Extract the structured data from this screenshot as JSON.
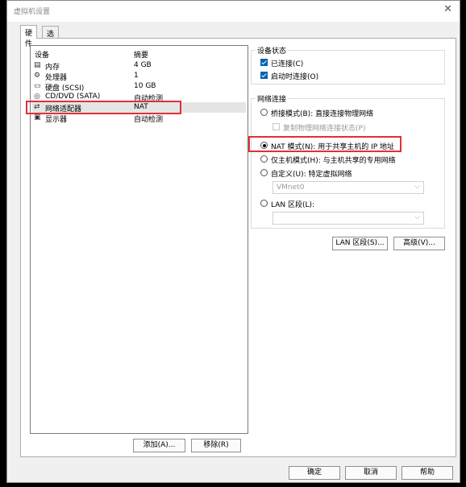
{
  "window": {
    "title": "虚拟机设置",
    "close_glyph": "✕"
  },
  "tabs": [
    {
      "label": "硬件",
      "active": true
    },
    {
      "label": "选项",
      "active": false
    }
  ],
  "device_list": {
    "col_device": "设备",
    "col_summary": "摘要",
    "items": [
      {
        "icon": "memory-icon",
        "glyph": "▤",
        "name": "内存",
        "summary": "4 GB"
      },
      {
        "icon": "processor-icon",
        "glyph": "⚙",
        "name": "处理器",
        "summary": "1"
      },
      {
        "icon": "disk-icon",
        "glyph": "▭",
        "name": "硬盘 (SCSI)",
        "summary": "10 GB"
      },
      {
        "icon": "cdrom-icon",
        "glyph": "◎",
        "name": "CD/DVD (SATA)",
        "summary": "自动检测"
      },
      {
        "icon": "network-icon",
        "glyph": "⇄",
        "name": "网络适配器",
        "summary": "NAT"
      },
      {
        "icon": "display-icon",
        "glyph": "▣",
        "name": "显示器",
        "summary": "自动检测"
      }
    ],
    "selected_index": 4
  },
  "buttons": {
    "add": "添加(A)...",
    "remove": "移除(R)",
    "ok": "确定",
    "cancel": "取消",
    "help": "帮助"
  },
  "device_status": {
    "title": "设备状态",
    "connected": {
      "label": "已连接(C)",
      "checked": true
    },
    "connect_on_power_on": {
      "label": "启动时连接(O)",
      "checked": true
    }
  },
  "network_connection": {
    "title": "网络连接",
    "bridged": {
      "label": "桥接模式(B): 直接连接物理网络",
      "checked": false
    },
    "replicate": {
      "label": "复制物理网络连接状态(P)",
      "checked": false,
      "disabled": true
    },
    "nat": {
      "label": "NAT 模式(N): 用于共享主机的 IP 地址",
      "checked": true
    },
    "host_only": {
      "label": "仅主机模式(H): 与主机共享的专用网络",
      "checked": false
    },
    "custom": {
      "label": "自定义(U): 特定虚拟网络",
      "checked": false
    },
    "custom_select": "VMnet0",
    "lan_segment": {
      "label": "LAN 区段(L):",
      "checked": false
    },
    "lan_select": "",
    "lan_segments_button": "LAN 区段(S)...",
    "advanced_button": "高级(V)..."
  },
  "colors": {
    "highlight": "#e0303a",
    "selection": "#e5e5e5",
    "accent": "#0063b1"
  }
}
